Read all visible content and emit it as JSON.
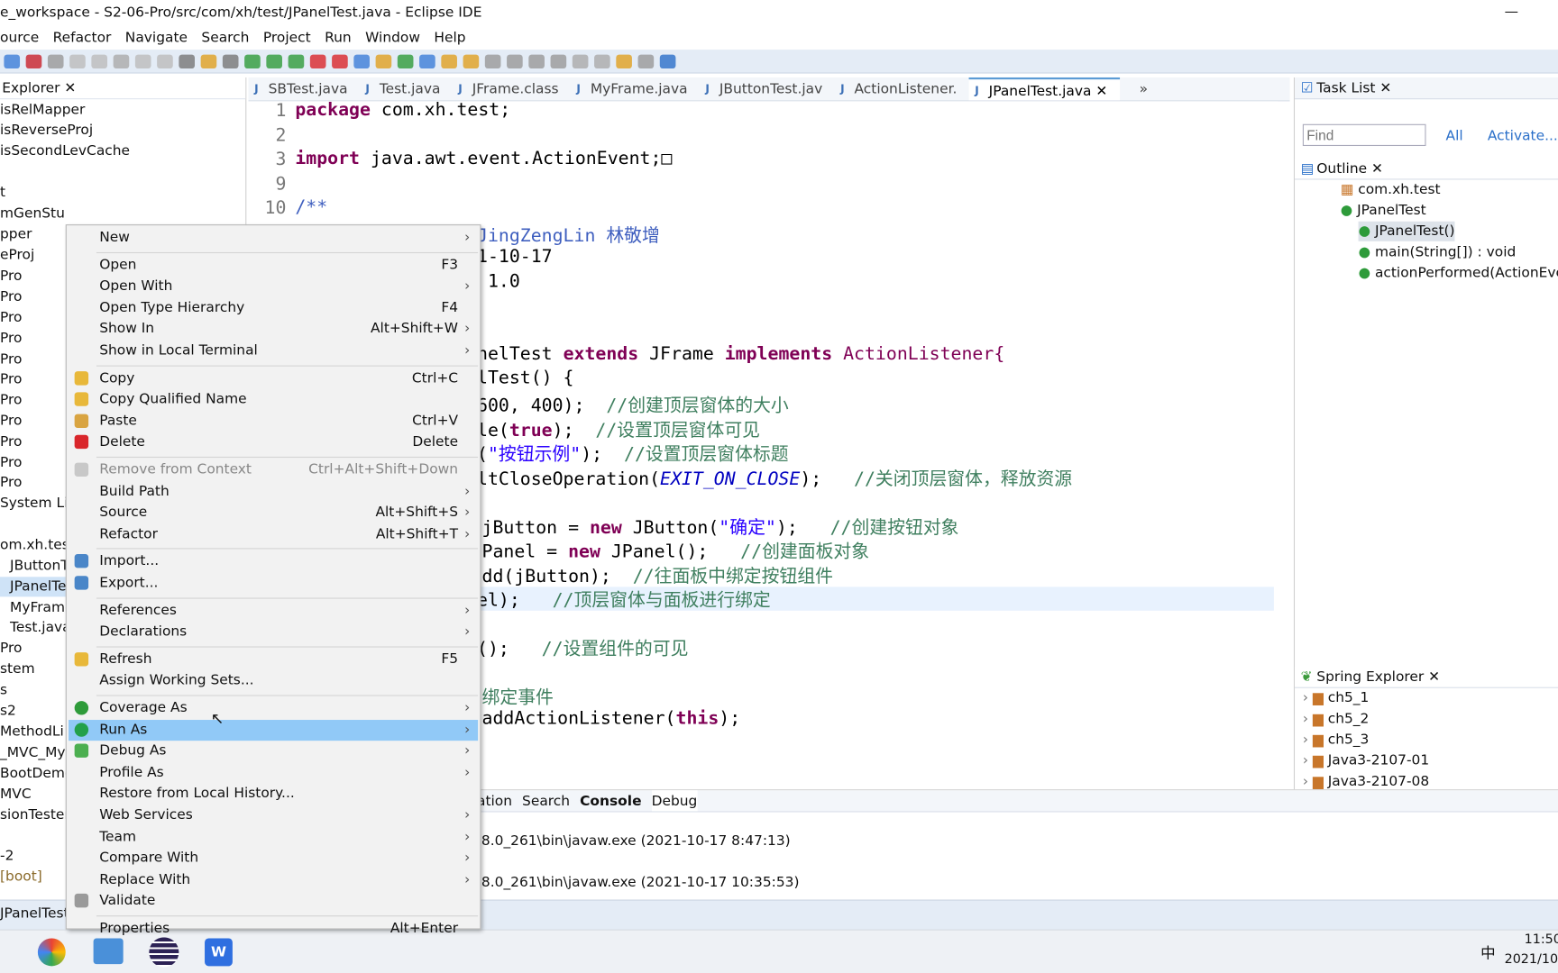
{
  "window": {
    "title": "e_workspace - S2-06-Pro/src/com/xh/test/JPanelTest.java - Eclipse IDE"
  },
  "menubar": [
    "ource",
    "Refactor",
    "Navigate",
    "Search",
    "Project",
    "Run",
    "Window",
    "Help"
  ],
  "explorer": {
    "title": "Explorer",
    "items": [
      "isRelMapper",
      "isReverseProj",
      "isSecondLevCache",
      "t",
      "mGenStu",
      "pper",
      "eProj",
      "Pro",
      "Pro",
      "Pro",
      "Pro",
      "Pro",
      "Pro",
      "Pro",
      "Pro",
      "Pro",
      "Pro",
      "Pro",
      "System Lib",
      "om.xh.test",
      "JButtonT",
      "JPanelTe",
      "MyFrame",
      "Test.java",
      "Pro",
      "stem",
      "s",
      "s2",
      "MethodLi",
      "_MVC_My",
      "BootDemo",
      "MVC",
      "sionTester",
      "-2",
      "[boot]"
    ],
    "selected": "JPanelTe"
  },
  "tabs": [
    {
      "label": "SBTest.java"
    },
    {
      "label": "Test.java"
    },
    {
      "label": "JFrame.class"
    },
    {
      "label": "MyFrame.java"
    },
    {
      "label": "JButtonTest.jav"
    },
    {
      "label": "ActionListener."
    },
    {
      "label": "JPanelTest.java",
      "active": true
    },
    {
      "label": "»"
    }
  ],
  "editor": {
    "line_numbers": [
      "1",
      "2",
      "3",
      "9",
      "10"
    ],
    "lines": [
      {
        "k": "package",
        "t": " com.xh.test;"
      },
      {
        "k": "import",
        "t": " java.awt.event.ActionEvent;□"
      },
      {
        "t": "/**"
      },
      {
        "t": "JingZengLin 林敬增"
      },
      {
        "t": "1-10-17"
      },
      {
        "t": " 1.0"
      },
      {
        "a": "nelTest ",
        "k": "extends",
        "b": " JFrame ",
        "k2": "implements",
        "c": " ActionListener{"
      },
      {
        "t": "lTest() {"
      },
      {
        "t": "600, 400);  ",
        "c": "//创建顶层窗体的大小"
      },
      {
        "a": "le(",
        "k": "true",
        "t": ");  ",
        "c": "//设置顶层窗体可见"
      },
      {
        "a": "(",
        "s": "\"按钮示例\"",
        "t": ");  ",
        "c": "//设置顶层窗体标题"
      },
      {
        "a": "ltCloseOperation(",
        "f": "EXIT_ON_CLOSE",
        "t": ");   ",
        "c": "//关闭顶层窗体，释放资源"
      },
      {
        "a": "jButton = ",
        "k": "new",
        "t": " JButton(",
        "s": "\"确定\"",
        "u": ");   ",
        "c": "//创建按钮对象"
      },
      {
        "a": "Panel = ",
        "k": "new",
        "t": " JPanel();   ",
        "c": "//创建面板对象"
      },
      {
        "t": "dd(jButton);  ",
        "c": "//往面板中绑定按钮组件"
      },
      {
        "t": "el);   ",
        "c": "//顶层窗体与面板进行绑定"
      },
      {
        "t": "();   ",
        "c": "//设置组件的可见"
      },
      {
        "c": "绑定事件"
      },
      {
        "a": "addActionListener(",
        "k": "this",
        "t": ");"
      }
    ]
  },
  "tasklist": {
    "title": "Task List",
    "find_placeholder": "Find",
    "all": "All",
    "activate": "Activate..."
  },
  "outline": {
    "title": "Outline",
    "items": [
      "com.xh.test",
      "JPanelTest",
      "JPanelTest()",
      "main(String[]) : void",
      "actionPerformed(ActionEvent)"
    ]
  },
  "spring": {
    "title": "Spring Explorer",
    "items": [
      "ch5_1",
      "ch5_2",
      "ch5_3",
      "Java3-2107-01",
      "Java3-2107-08"
    ]
  },
  "bottom": {
    "tabs": [
      "ation",
      "Search",
      "Console",
      "Debug"
    ],
    "lines": [
      ".8.0_261\\bin\\javaw.exe (2021-10-17 8:47:13)",
      ".8.0_261\\bin\\javaw.exe (2021-10-17 10:35:53)"
    ]
  },
  "status": {
    "left": "JPanelTest"
  },
  "taskbar": {
    "time": "11:50",
    "date": "2021/10",
    "ime": "中"
  },
  "context_menu": [
    {
      "label": "New",
      "arrow": true
    },
    {
      "sep": true
    },
    {
      "label": "Open",
      "shortcut": "F3"
    },
    {
      "label": "Open With",
      "arrow": true
    },
    {
      "label": "Open Type Hierarchy",
      "shortcut": "F4"
    },
    {
      "label": "Show In",
      "shortcut": "Alt+Shift+W",
      "arrow": true
    },
    {
      "label": "Show in Local Terminal",
      "arrow": true
    },
    {
      "sep": true
    },
    {
      "label": "Copy",
      "shortcut": "Ctrl+C",
      "icon": "copy-icon",
      "color": "#e8b83a"
    },
    {
      "label": "Copy Qualified Name",
      "icon": "copy-qualified-icon",
      "color": "#e8b83a"
    },
    {
      "label": "Paste",
      "shortcut": "Ctrl+V",
      "icon": "paste-icon",
      "color": "#d9a441"
    },
    {
      "label": "Delete",
      "shortcut": "Delete",
      "icon": "delete-icon",
      "color": "#d9262b"
    },
    {
      "sep": true
    },
    {
      "label": "Remove from Context",
      "shortcut": "Ctrl+Alt+Shift+Down",
      "disabled": true,
      "icon": "remove-context-icon",
      "color": "#c8c8c8"
    },
    {
      "label": "Build Path",
      "arrow": true
    },
    {
      "label": "Source",
      "shortcut": "Alt+Shift+S",
      "arrow": true
    },
    {
      "label": "Refactor",
      "shortcut": "Alt+Shift+T",
      "arrow": true
    },
    {
      "sep": true
    },
    {
      "label": "Import...",
      "icon": "import-icon",
      "color": "#4a86c8"
    },
    {
      "label": "Export...",
      "icon": "export-icon",
      "color": "#4a86c8"
    },
    {
      "sep": true
    },
    {
      "label": "References",
      "arrow": true
    },
    {
      "label": "Declarations",
      "arrow": true
    },
    {
      "sep": true
    },
    {
      "label": "Refresh",
      "shortcut": "F5",
      "icon": "refresh-icon",
      "color": "#e8b83a"
    },
    {
      "label": "Assign Working Sets..."
    },
    {
      "sep": true
    },
    {
      "label": "Coverage As",
      "arrow": true,
      "icon": "coverage-icon",
      "color": "#2e9b3a"
    },
    {
      "label": "Run As",
      "arrow": true,
      "icon": "run-icon",
      "color": "#23a04a",
      "hover": true
    },
    {
      "label": "Debug As",
      "arrow": true,
      "icon": "debug-icon",
      "color": "#4caf50"
    },
    {
      "label": "Profile As",
      "arrow": true
    },
    {
      "label": "Restore from Local History..."
    },
    {
      "label": "Web Services",
      "arrow": true
    },
    {
      "label": "Team",
      "arrow": true
    },
    {
      "label": "Compare With",
      "arrow": true
    },
    {
      "label": "Replace With",
      "arrow": true
    },
    {
      "label": "Validate",
      "icon": "validate-icon",
      "color": "#9a9a9a"
    },
    {
      "sep": true
    },
    {
      "label": "Properties",
      "shortcut": "Alt+Enter"
    }
  ]
}
